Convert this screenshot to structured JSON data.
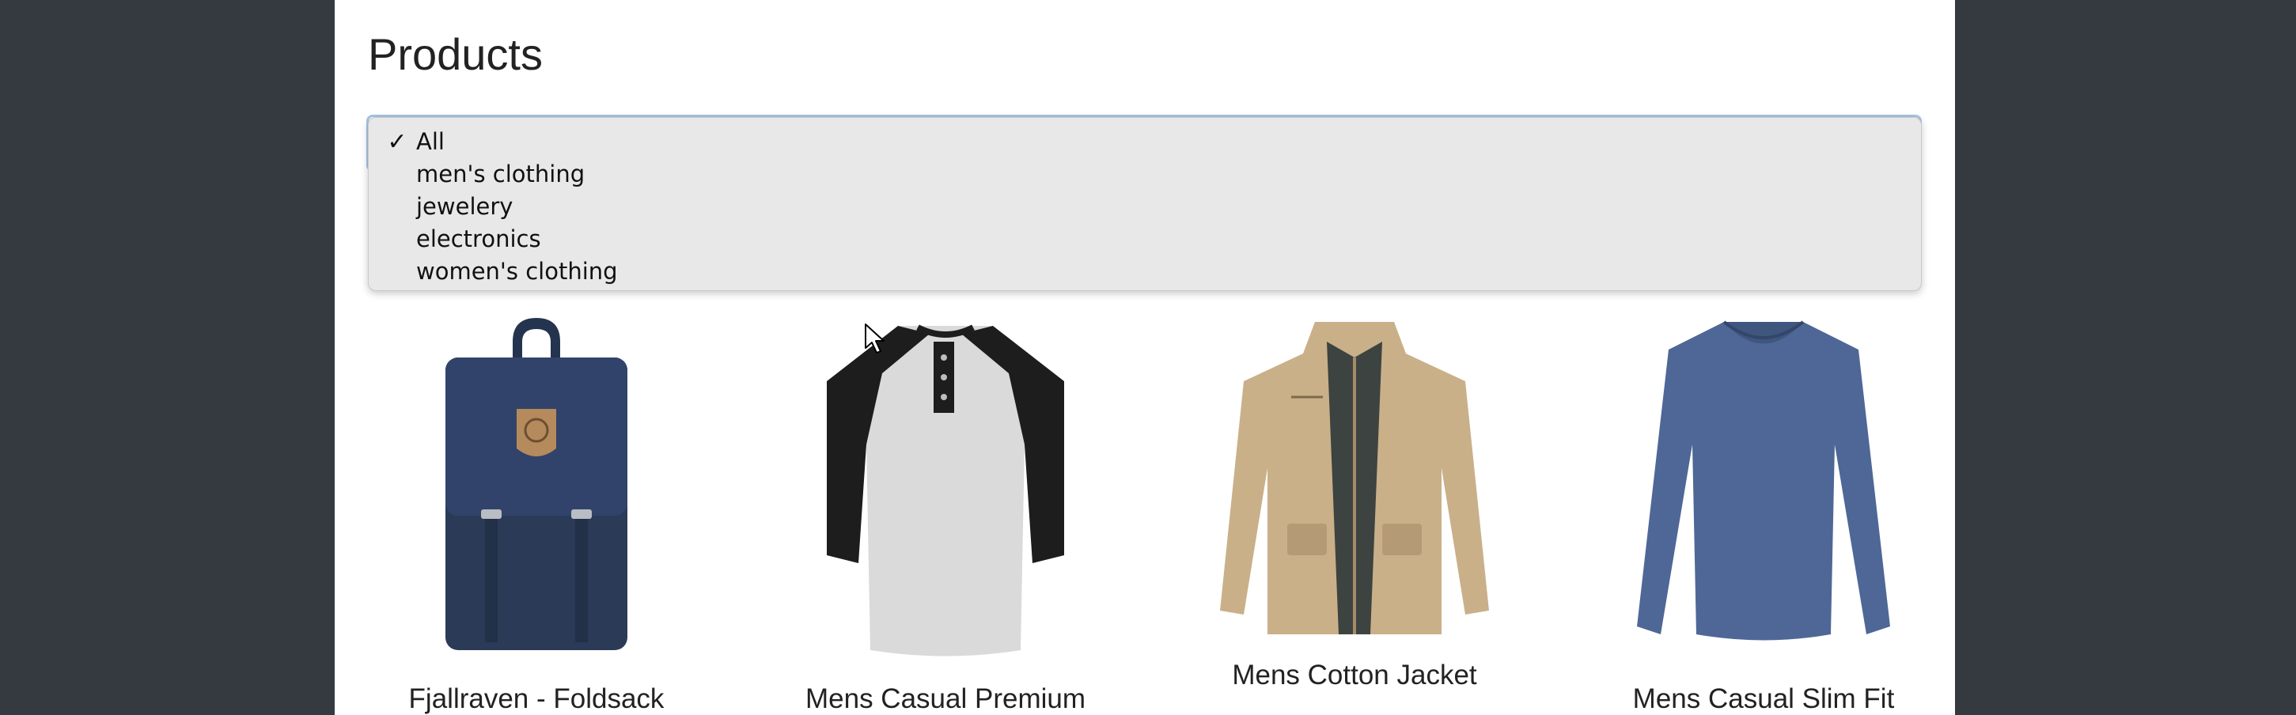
{
  "page": {
    "title": "Products"
  },
  "filter": {
    "selected": "All",
    "options": [
      "All",
      "men's clothing",
      "jewelery",
      "electronics",
      "women's clothing"
    ],
    "check_glyph": "✓"
  },
  "products": [
    {
      "title": "Fjallraven - Foldsack",
      "image_icon": "backpack-image"
    },
    {
      "title": "Mens Casual Premium",
      "image_icon": "raglan-shirt-image"
    },
    {
      "title": "Mens Cotton Jacket",
      "image_icon": "jacket-image"
    },
    {
      "title": "Mens Casual Slim Fit",
      "image_icon": "long-sleeve-shirt-image"
    }
  ],
  "colors": {
    "backdrop": "#343a40",
    "page_bg": "#ffffff",
    "dropdown_bg": "#e8e8e8",
    "focus_border": "#a8c3e6",
    "backpack": "#2b3b57",
    "jacket": "#c9b089",
    "slim_shirt": "#4e6796"
  }
}
